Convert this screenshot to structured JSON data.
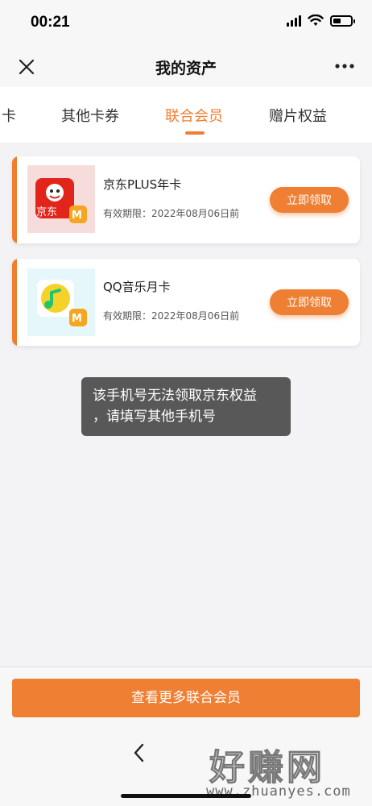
{
  "status_bar": {
    "time": "00:21"
  },
  "nav": {
    "title": "我的资产"
  },
  "tabs": [
    {
      "label": "卡"
    },
    {
      "label": "其他卡券"
    },
    {
      "label": "联合会员",
      "active": true
    },
    {
      "label": "赠片权益"
    }
  ],
  "cards": [
    {
      "title": "京东PLUS年卡",
      "validity": "有效期限：2022年08月06日前",
      "button": "立即领取",
      "logo_text": "京东"
    },
    {
      "title": "QQ音乐月卡",
      "validity": "有效期限：2022年08月06日前",
      "button": "立即领取"
    }
  ],
  "toast": {
    "line1": "该手机号无法领取京东权益",
    "line2": "，请填写其他手机号"
  },
  "bottom": {
    "button": "查看更多联合会员"
  },
  "watermark": {
    "text": "好赚网",
    "url": "www.zhuanyes.com"
  },
  "colors": {
    "accent": "#ef7f2f",
    "jd_red": "#e1251b",
    "mgtv": "#f6a51e",
    "qq_green": "#1fc46e"
  },
  "icons": [
    "close-icon",
    "more-icon",
    "jd-logo",
    "mgtv-logo",
    "qq-music-logo",
    "back-arrow-icon"
  ]
}
